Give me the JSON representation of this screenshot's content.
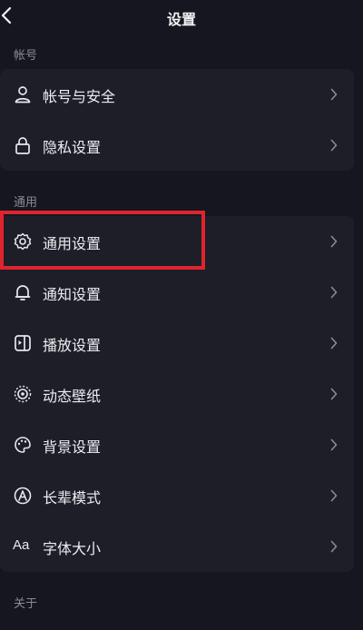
{
  "header": {
    "title": "设置"
  },
  "sections": {
    "account": {
      "label": "帐号",
      "items": [
        {
          "label": "帐号与安全",
          "icon": "person-icon"
        },
        {
          "label": "隐私设置",
          "icon": "lock-icon"
        }
      ]
    },
    "general": {
      "label": "通用",
      "items": [
        {
          "label": "通用设置",
          "icon": "gear-icon"
        },
        {
          "label": "通知设置",
          "icon": "bell-icon"
        },
        {
          "label": "播放设置",
          "icon": "play-settings-icon"
        },
        {
          "label": "动态壁纸",
          "icon": "live-wallpaper-icon"
        },
        {
          "label": "背景设置",
          "icon": "palette-icon"
        },
        {
          "label": "长辈模式",
          "icon": "elder-mode-icon"
        },
        {
          "label": "字体大小",
          "icon": "font-size-icon",
          "icon_text": "Aa"
        }
      ]
    },
    "about": {
      "label": "关于"
    }
  },
  "highlight": {
    "color": "#e0242f",
    "target": "通用设置"
  },
  "colors": {
    "background": "#15161f",
    "card": "#1d1e28",
    "section_label": "#8a8b93"
  }
}
